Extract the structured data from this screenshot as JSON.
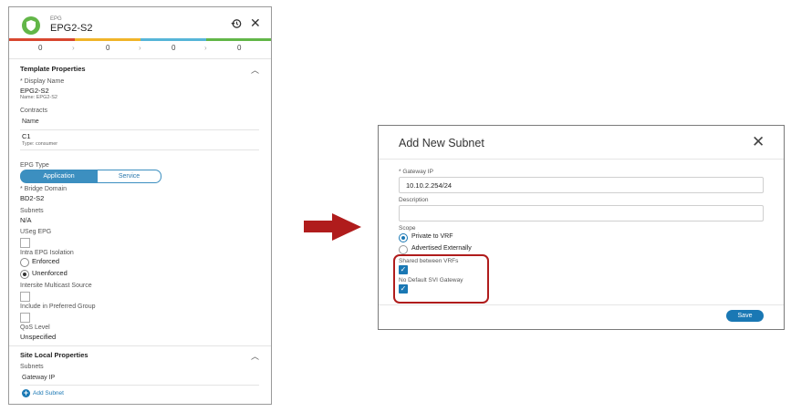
{
  "epg_panel": {
    "type_label": "EPG",
    "title": "EPG2-S2",
    "counts": [
      "0",
      "0",
      "0",
      "0"
    ],
    "template_properties": {
      "heading": "Template Properties",
      "display_name_label": "* Display Name",
      "display_name_value": "EPG2-S2",
      "name_note": "Name: EPG2-S2",
      "contracts_label": "Contracts",
      "contracts_name_header": "Name",
      "contract_name": "C1",
      "contract_type": "Type: consumer",
      "epg_type_label": "EPG Type",
      "epg_type_options": [
        "Application",
        "Service"
      ],
      "epg_type_selected": "Application",
      "bridge_domain_label": "* Bridge Domain",
      "bridge_domain_value": "BD2-S2",
      "subnets_label": "Subnets",
      "subnets_value": "N/A",
      "useg_label": "USeg EPG",
      "intra_label": "Intra EPG Isolation",
      "intra_options": [
        "Enforced",
        "Unenforced"
      ],
      "intra_selected": "Unenforced",
      "multicast_label": "Intersite Multicast Source",
      "preferred_label": "Include in Preferred Group",
      "qos_label": "QoS Level",
      "qos_value": "Unspecified"
    },
    "site_local": {
      "heading": "Site Local Properties",
      "subnets_label": "Subnets",
      "gateway_header": "Gateway IP",
      "add_subnet": "Add Subnet"
    }
  },
  "dialog": {
    "title": "Add New Subnet",
    "gateway_label": "* Gateway IP",
    "gateway_value": "10.10.2.254/24",
    "description_label": "Description",
    "description_value": "",
    "scope_label": "Scope",
    "scope_options": [
      "Private to VRF",
      "Advertised Externally"
    ],
    "scope_selected": "Private to VRF",
    "shared_label": "Shared between VRFs",
    "shared_checked": true,
    "no_default_label": "No Default SVI Gateway",
    "no_default_checked": true,
    "save_label": "Save"
  },
  "colors": {
    "accent_blue": "#1a78b4",
    "highlight_red": "#b01c1c",
    "epg_green": "#62b648",
    "stripe": [
      "#d8472f",
      "#f0b429",
      "#57b5d8",
      "#62b648"
    ]
  }
}
